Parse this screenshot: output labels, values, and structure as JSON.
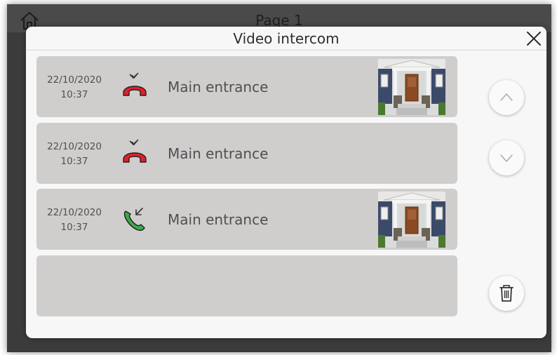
{
  "background": {
    "page_title": "Page 1",
    "home_icon": "home-icon"
  },
  "modal": {
    "title": "Video intercom",
    "close_icon": "close-icon"
  },
  "calls": [
    {
      "date": "22/10/2020",
      "time": "10:37",
      "label": "Main entrance",
      "status": "missed",
      "icon": "missed-call-icon",
      "icon_color": "#e0202a",
      "has_snapshot": true
    },
    {
      "date": "22/10/2020",
      "time": "10:37",
      "label": "Main entrance",
      "status": "missed",
      "icon": "missed-call-icon",
      "icon_color": "#e0202a",
      "has_snapshot": false
    },
    {
      "date": "22/10/2020",
      "time": "10:37",
      "label": "Main entrance",
      "status": "answered",
      "icon": "incoming-call-icon",
      "icon_color": "#3aaa49",
      "has_snapshot": true
    }
  ],
  "controls": {
    "scroll_up_icon": "chevron-up-icon",
    "scroll_down_icon": "chevron-down-icon",
    "delete_icon": "trash-icon"
  },
  "colors": {
    "row_background": "#d0cdcd",
    "modal_background": "#f7f7f7",
    "missed": "#e0202a",
    "answered": "#3aaa49"
  }
}
